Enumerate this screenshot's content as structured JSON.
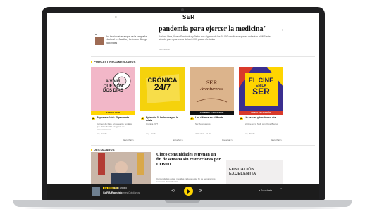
{
  "header": {
    "logo": "SER",
    "badge": ""
  },
  "side_news": {
    "text": "Así ha sido el arranque de la campaña electoral en Castilla y León con Ábrego nacionales"
  },
  "hero": {
    "title": "pandemia para ejercer la medicina\"",
    "description": "Adriana Vera, Álvaro Fernández y Pedro son algunos de los 10.000 candidatos que se enfrentan al MIR este sábado para optar a una de las 8.000 plazas ofertadas",
    "more": "Leer noticia"
  },
  "podcasts": {
    "section_label": "PODCAST RECOMENDADOS",
    "cards": [
      {
        "cover_lines": [
          "A VIVIR",
          "QUE SON",
          "DOS DÍAS"
        ],
        "tag": "ACTUALIDAD",
        "title": "Reportaje: Vidi: El paseante",
        "desc": "Carmen de Dios, el paseante temático que visita Sevilla y lugares no convencionales",
        "meta": "Hoy · 34 Min",
        "listen": "Escuchar ▷"
      },
      {
        "cover_lines": [
          "CRÓNICA",
          "24/7"
        ],
        "tag": "",
        "title": "Episodio 3: La locura por la crisis",
        "desc": "Cronica 24/7",
        "meta": "Hoy · 26 Min",
        "listen": "Escuchar ▷"
      },
      {
        "cover_lines": [
          "SER",
          "Aventureros"
        ],
        "tag": "CULTURA Y SOCIEDAD",
        "title": "Los últimos en el Monte",
        "desc": "Ser Aventureros",
        "meta": "28/01/2022 · 24 Min",
        "listen": "Escuchar ▷"
      },
      {
        "cover_lines": [
          "EL CINE",
          "EN LA",
          "SER"
        ],
        "tag": "CINE Y TELEVISIÓN",
        "title": "Un oscuro y tenebroso día",
        "desc": "El Cine en la SER con Pepa Blanes",
        "meta": "Hoy · 55 Min",
        "listen": "Escuchar ▷"
      }
    ]
  },
  "destacados": {
    "section_label": "DESTACADOS",
    "title": "Cinco comunidades estrenan un fin de semana sin restricciones por COVID",
    "desc": "Comunidades cuyas medidas caducan este fin de semana tras semanas de incidencia",
    "ad": {
      "line1": "FUNDACIÓN",
      "line2": "EXCELENTIA"
    }
  },
  "player": {
    "live": "EN DIRECTO",
    "show": "Radio Madrid",
    "host": "SoRA Romero",
    "sub": "Informes Cotidianos",
    "subscribe": "Suscríbete"
  },
  "colors": {
    "accent": "#ffd500",
    "player_bg": "#1c1c1c",
    "card2_bg": "#f5d20c",
    "card1_bg": "#f2b7c8",
    "card3_bg": "#dcb48c",
    "card4_bg": "#3b2f8f"
  }
}
